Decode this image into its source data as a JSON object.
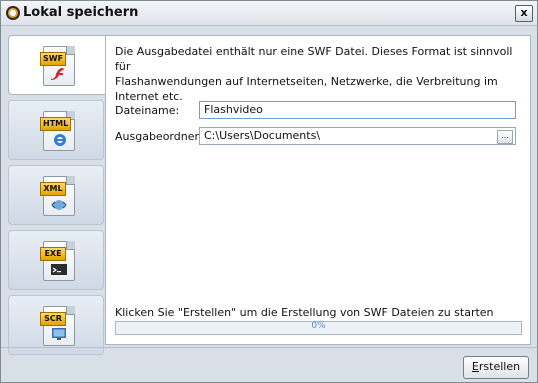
{
  "window": {
    "title": "Lokal speichern",
    "close_label": "x"
  },
  "tabs": [
    {
      "tag": "SWF",
      "icon": "swf-file-icon",
      "active": true
    },
    {
      "tag": "HTML",
      "icon": "html-file-icon",
      "active": false
    },
    {
      "tag": "XML",
      "icon": "xml-file-icon",
      "active": false
    },
    {
      "tag": "EXE",
      "icon": "exe-file-icon",
      "active": false
    },
    {
      "tag": "SCR",
      "icon": "scr-file-icon",
      "active": false
    }
  ],
  "panel": {
    "description_line1": "Die Ausgabedatei enthält nur eine SWF Datei. Dieses Format ist sinnvoll für",
    "description_line2": "Flashanwendungen auf Internetseiten, Netzwerke, die Verbreitung im Internet etc.",
    "filename_label": "Dateiname:",
    "filename_value": "Flashvideo",
    "folder_label": "Ausgabeordner:",
    "folder_value": "C:\\Users\\Documents\\",
    "browse_label": "...",
    "hint": "Klicken Sie \"Erstellen\" um die Erstellung von SWF Dateien zu starten",
    "progress_percent": 0,
    "progress_label": "0%"
  },
  "footer": {
    "create_label_first": "E",
    "create_label_rest": "rstellen"
  },
  "colors": {
    "accent": "#5a8fd0",
    "tag_fill": "#e3a300",
    "panel_bg": "#d8dfe7"
  }
}
